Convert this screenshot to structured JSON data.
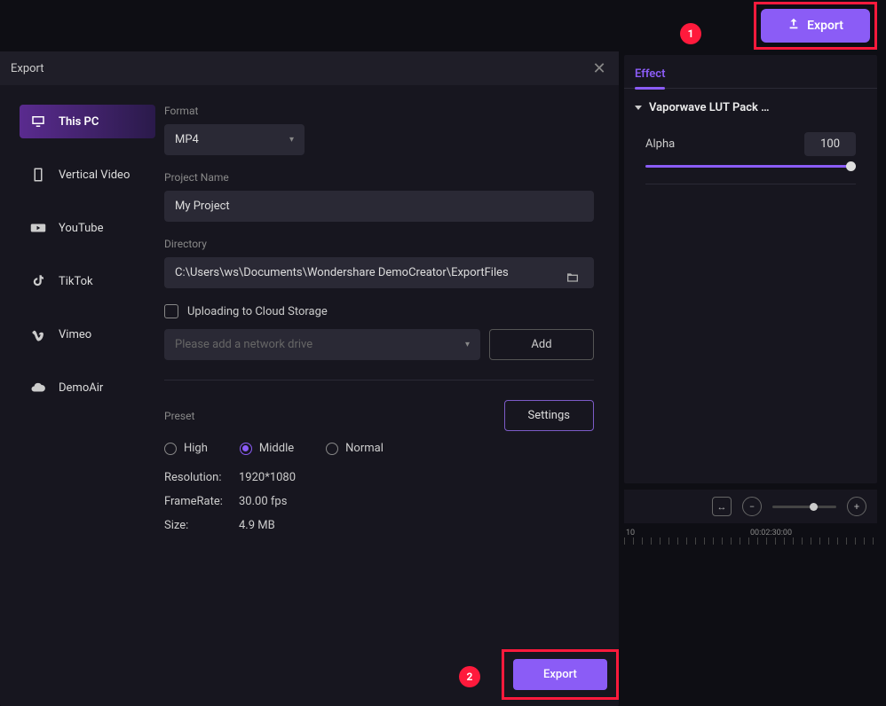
{
  "topbar": {
    "export_label": "Export"
  },
  "badges": {
    "one": "1",
    "two": "2"
  },
  "dialog": {
    "title": "Export",
    "sidebar": {
      "items": [
        {
          "label": "This PC"
        },
        {
          "label": "Vertical Video"
        },
        {
          "label": "YouTube"
        },
        {
          "label": "TikTok"
        },
        {
          "label": "Vimeo"
        },
        {
          "label": "DemoAir"
        }
      ]
    },
    "form": {
      "format_label": "Format",
      "format_value": "MP4",
      "project_name_label": "Project Name",
      "project_name_value": "My Project",
      "directory_label": "Directory",
      "directory_value": "C:\\Users\\ws\\Documents\\Wondershare DemoCreator\\ExportFiles",
      "cloud_checkbox_label": "Uploading to Cloud Storage",
      "cloud_placeholder": "Please add a network drive",
      "add_btn": "Add",
      "preset_label": "Preset",
      "settings_btn": "Settings",
      "presets": {
        "high": "High",
        "middle": "Middle",
        "normal": "Normal"
      },
      "resolution_key": "Resolution:",
      "resolution_val": "1920*1080",
      "framerate_key": "FrameRate:",
      "framerate_val": "30.00 fps",
      "size_key": "Size:",
      "size_val": "4.9 MB"
    },
    "bottom_export": "Export"
  },
  "effect": {
    "tab": "Effect",
    "title": "Vaporwave LUT Pack …",
    "alpha_label": "Alpha",
    "alpha_value": "100"
  },
  "timeline": {
    "mark1": "10",
    "mark2": "00:02:30:00"
  }
}
